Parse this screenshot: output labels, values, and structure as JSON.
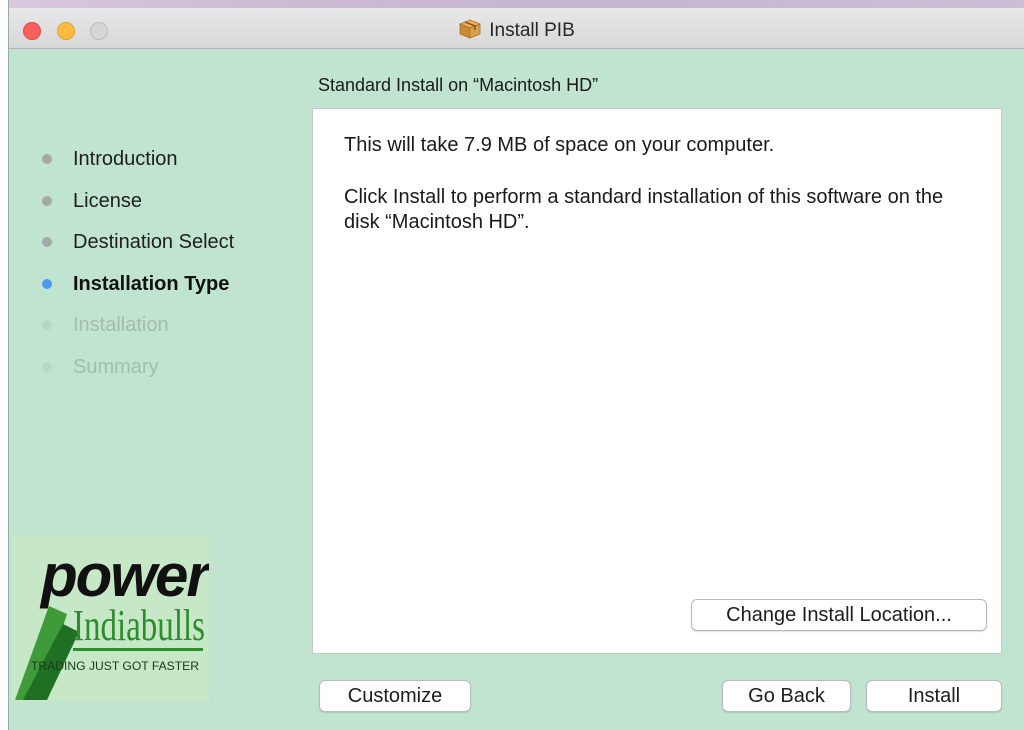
{
  "window": {
    "title": "Install PIB"
  },
  "pane": {
    "subtitle": "Standard Install on “Macintosh HD”",
    "line1": "This will take 7.9 MB of space on your computer.",
    "line2": "Click Install to perform a standard installation of this software on the disk “Macintosh HD”."
  },
  "steps": [
    {
      "label": "Introduction",
      "state": "done"
    },
    {
      "label": "License",
      "state": "done"
    },
    {
      "label": "Destination Select",
      "state": "done"
    },
    {
      "label": "Installation Type",
      "state": "current"
    },
    {
      "label": "Installation",
      "state": "pending"
    },
    {
      "label": "Summary",
      "state": "pending"
    }
  ],
  "buttons": {
    "change_location": "Change Install Location...",
    "customize": "Customize",
    "go_back": "Go Back",
    "install": "Install"
  },
  "logo": {
    "word": "power",
    "brand": "Indiabulls",
    "tagline": "TRADING JUST GOT FASTER"
  },
  "colors": {
    "sidebar_bg": "#c0e4cf",
    "active_step_dot": "#4d9af0",
    "close_button": "#fc605c",
    "minimize_button": "#fdbc40",
    "logo_green": "#2e8b2e"
  },
  "icons": {
    "title_icon": "package-icon"
  }
}
